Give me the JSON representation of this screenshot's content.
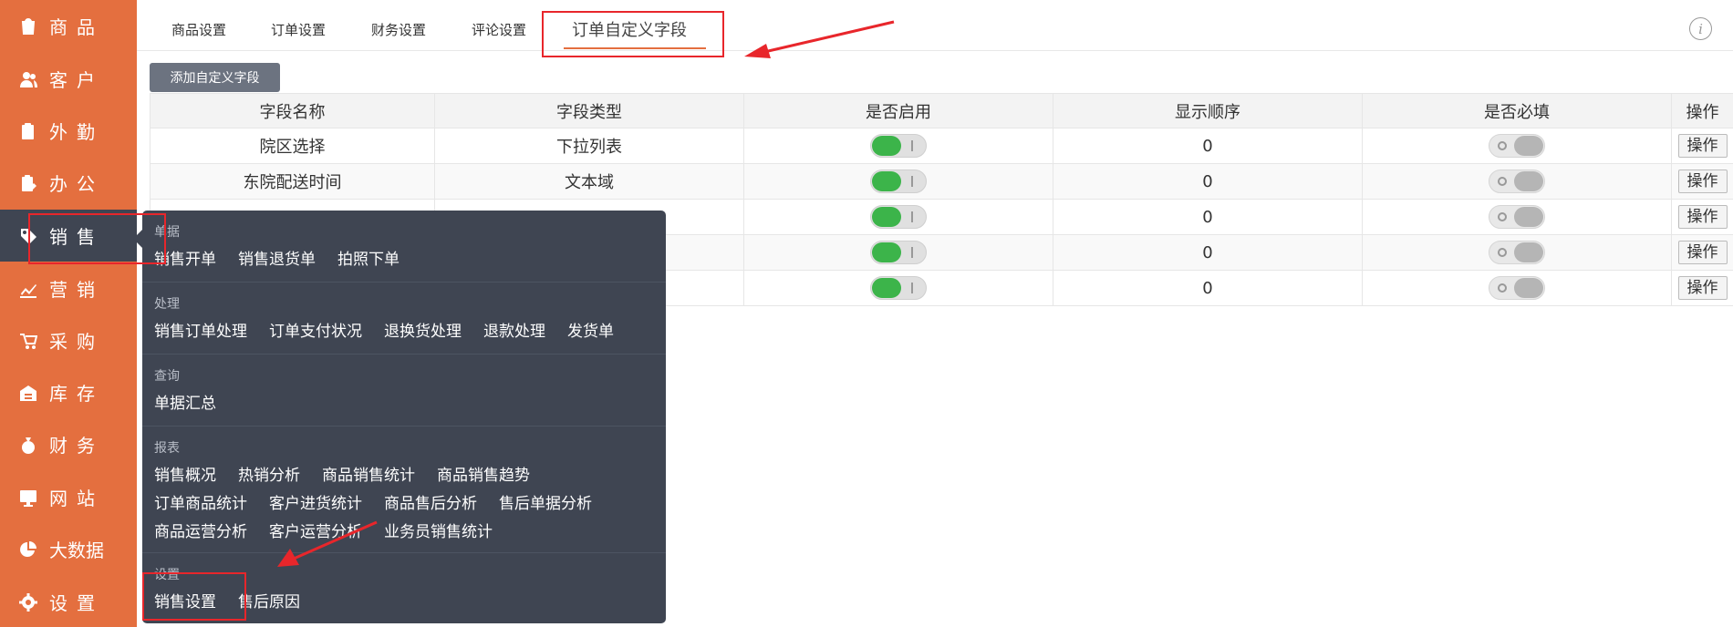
{
  "sidebar": {
    "items": [
      {
        "label": "商品",
        "icon": "bag-icon"
      },
      {
        "label": "客户",
        "icon": "user-icon"
      },
      {
        "label": "外勤",
        "icon": "clipboard-icon"
      },
      {
        "label": "办公",
        "icon": "clipboard-edit-icon"
      },
      {
        "label": "销售",
        "icon": "tag-icon"
      },
      {
        "label": "营销",
        "icon": "trend-icon"
      },
      {
        "label": "采购",
        "icon": "cart-icon"
      },
      {
        "label": "库存",
        "icon": "warehouse-icon"
      },
      {
        "label": "财务",
        "icon": "money-bag-icon"
      },
      {
        "label": "网站",
        "icon": "monitor-icon"
      },
      {
        "label": "大数据",
        "icon": "pie-chart-icon"
      },
      {
        "label": "设置",
        "icon": "gear-icon"
      }
    ],
    "active_index": 4
  },
  "tabs": [
    {
      "label": "商品设置"
    },
    {
      "label": "订单设置"
    },
    {
      "label": "财务设置"
    },
    {
      "label": "评论设置"
    },
    {
      "label": "订单自定义字段"
    }
  ],
  "active_tab": 4,
  "toolbar": {
    "add_label": "添加自定义字段"
  },
  "table": {
    "headers": [
      "字段名称",
      "字段类型",
      "是否启用",
      "显示顺序",
      "是否必填",
      "操作"
    ],
    "rows": [
      {
        "name": "院区选择",
        "type": "下拉列表",
        "enabled": true,
        "order": "0",
        "required": false,
        "action": "操作"
      },
      {
        "name": "东院配送时间",
        "type": "文本域",
        "enabled": true,
        "order": "0",
        "required": false,
        "action": "操作"
      },
      {
        "name": "",
        "type": "",
        "enabled": true,
        "order": "0",
        "required": false,
        "action": "操作"
      },
      {
        "name": "",
        "type": "",
        "enabled": true,
        "order": "0",
        "required": false,
        "action": "操作"
      },
      {
        "name": "",
        "type": "",
        "enabled": true,
        "order": "0",
        "required": false,
        "action": "操作"
      }
    ]
  },
  "flyout": {
    "sections": [
      {
        "title": "单据",
        "rows": [
          [
            "销售开单",
            "销售退货单",
            "拍照下单"
          ]
        ]
      },
      {
        "title": "处理",
        "rows": [
          [
            "销售订单处理",
            "订单支付状况",
            "退换货处理",
            "退款处理",
            "发货单"
          ]
        ]
      },
      {
        "title": "查询",
        "rows": [
          [
            "单据汇总"
          ]
        ]
      },
      {
        "title": "报表",
        "rows": [
          [
            "销售概况",
            "热销分析",
            "商品销售统计",
            "商品销售趋势"
          ],
          [
            "订单商品统计",
            "客户进货统计",
            "商品售后分析",
            "售后单据分析"
          ],
          [
            "商品运营分析",
            "客户运营分析",
            "业务员销售统计"
          ]
        ]
      },
      {
        "title": "设置",
        "rows": [
          [
            "销售设置",
            "售后原因"
          ]
        ]
      }
    ]
  },
  "colors": {
    "sidebar": "#e46f3f",
    "sidebar_active": "#3f4552",
    "toggle_on": "#3cb44a",
    "annotation": "#e8262b"
  }
}
